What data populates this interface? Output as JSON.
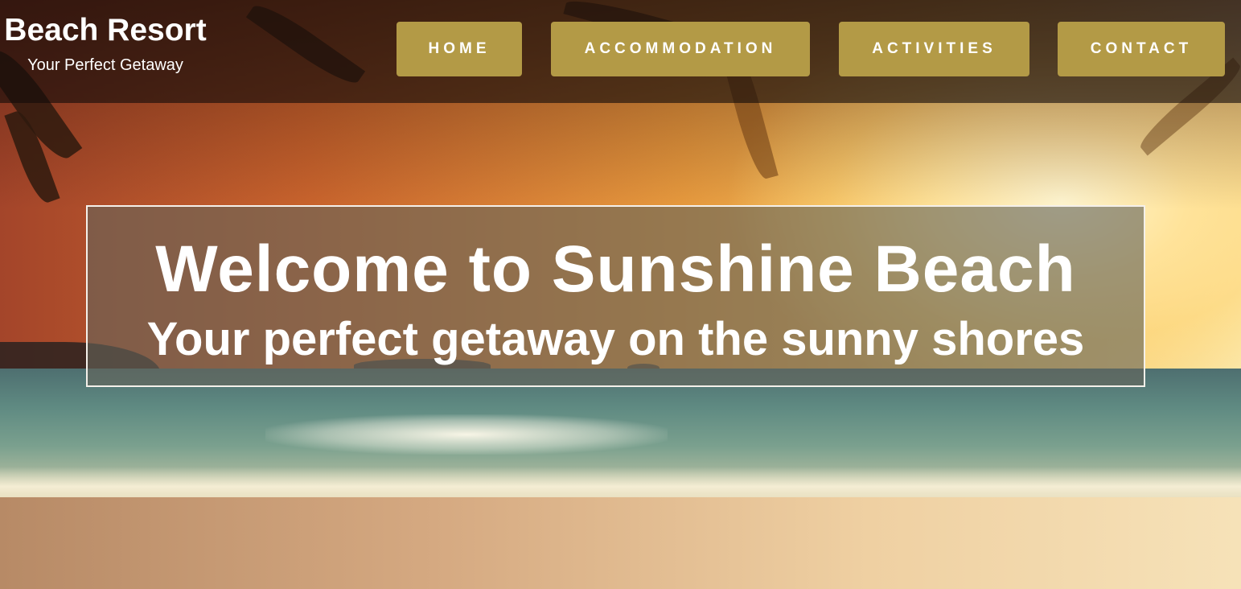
{
  "header": {
    "brand_title": "Beach Resort",
    "brand_tagline": "Your Perfect Getaway"
  },
  "nav": {
    "items": [
      {
        "label": "HOME"
      },
      {
        "label": "ACCOMMODATION"
      },
      {
        "label": "ACTIVITIES"
      },
      {
        "label": "CONTACT"
      }
    ]
  },
  "hero": {
    "title": "Welcome to Sunshine Beach",
    "subtitle": "Your perfect getaway on the sunny shores"
  },
  "colors": {
    "nav_button": "#b39a46",
    "header_overlay": "rgba(20,12,10,0.62)",
    "hero_overlay": "rgba(100,100,90,0.62)",
    "text": "#ffffff"
  }
}
